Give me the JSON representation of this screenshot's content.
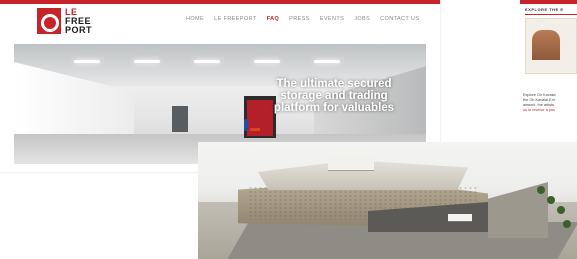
{
  "site": {
    "logo_lines": [
      "LE",
      "FREE",
      "PORT"
    ],
    "nav": [
      "HOME",
      "LE FREEPORT",
      "FAQ",
      "PRESS",
      "EVENTS",
      "JOBS",
      "CONTACT US"
    ],
    "active_nav": "FAQ",
    "hero_headline_lines": [
      "The ultimate secured",
      "storage and trading",
      "platform for valuables"
    ]
  },
  "side_panel": {
    "title": "EXPLORE THE E",
    "text_lines": [
      "Explore Oh Kavalai",
      "the Oh Kavalai-Em",
      "artwork, the artists",
      "us to receive a pos"
    ]
  },
  "colors": {
    "brand_red": "#c8232b",
    "nav_grey": "#8a8a8a"
  }
}
